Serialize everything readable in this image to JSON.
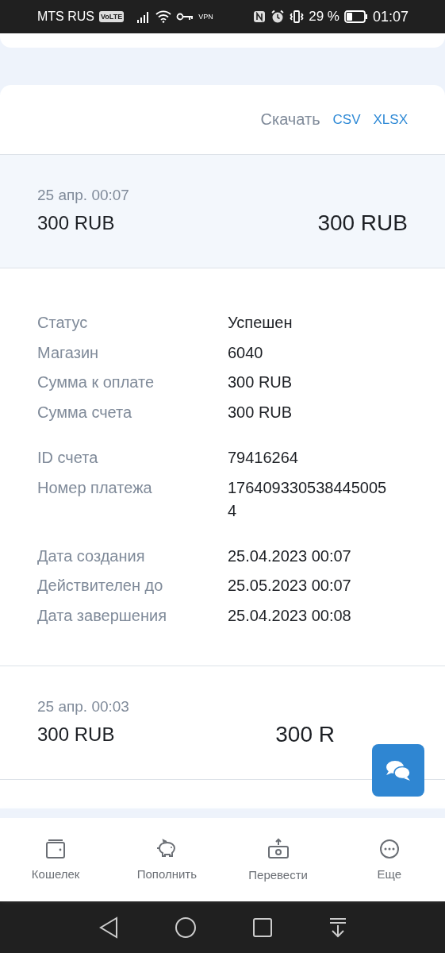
{
  "status_bar": {
    "carrier": "MTS RUS",
    "volte": "VoLTE",
    "vpn": "VPN",
    "battery": "29 %",
    "time": "01:07"
  },
  "download": {
    "label": "Скачать",
    "formats": [
      "CSV",
      "XLSX"
    ]
  },
  "transactions": [
    {
      "date": "25 апр. 00:07",
      "amount": "300 RUB",
      "total": "300 RUB",
      "expanded": true,
      "details": [
        [
          {
            "label": "Статус",
            "value": "Успешен"
          },
          {
            "label": "Магазин",
            "value": "6040"
          },
          {
            "label": "Сумма к оплате",
            "value": "300 RUB"
          },
          {
            "label": "Сумма счета",
            "value": "300 RUB"
          }
        ],
        [
          {
            "label": "ID счета",
            "value": "79416264"
          },
          {
            "label": "Номер платежа",
            "value": "176409330538445005 4"
          }
        ],
        [
          {
            "label": "Дата создания",
            "value": "25.04.2023 00:07"
          },
          {
            "label": "Действителен до",
            "value": "25.05.2023 00:07"
          },
          {
            "label": "Дата завершения",
            "value": "25.04.2023 00:08"
          }
        ]
      ]
    },
    {
      "date": "25 апр. 00:03",
      "amount": "300 RUB",
      "total": "300 R",
      "expanded": false
    }
  ],
  "nav": [
    {
      "kind": "wallet",
      "label": "Кошелек"
    },
    {
      "kind": "piggy",
      "label": "Пополнить"
    },
    {
      "kind": "transfer",
      "label": "Перевести"
    },
    {
      "kind": "more",
      "label": "Еще"
    }
  ]
}
